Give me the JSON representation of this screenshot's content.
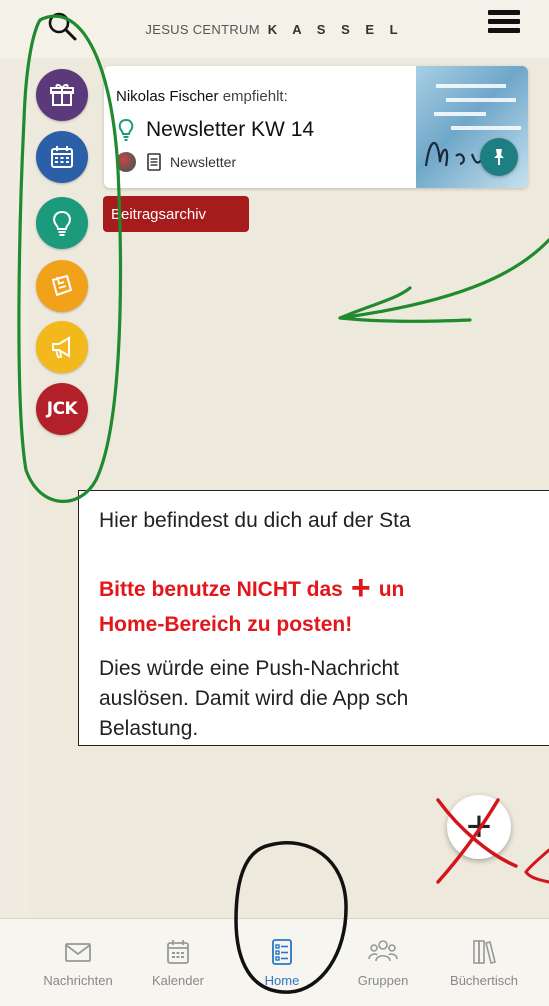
{
  "header": {
    "brand_light": "JESUS CENTRUM",
    "brand_bold": "K A S S E L"
  },
  "sidebar": {
    "items": [
      {
        "icon": "gift-icon",
        "color": "#5a3a7a"
      },
      {
        "icon": "calendar-icon",
        "color": "#2b5fa8"
      },
      {
        "icon": "lightbulb-icon",
        "color": "#1c9a7c"
      },
      {
        "icon": "note-icon",
        "color": "#f2a21a"
      },
      {
        "icon": "megaphone-icon",
        "color": "#f3b91c"
      },
      {
        "icon": "jck-logo-icon",
        "color": "#b3202a",
        "label": "JCK"
      }
    ]
  },
  "feed": {
    "card": {
      "recommender": "Nikolas Fischer",
      "recommend_label": "empfiehlt:",
      "title": "Newsletter KW 14",
      "category": "Newsletter"
    },
    "archive_button": "Beitragsarchiv"
  },
  "notice": {
    "line1": "Hier befindest du dich auf der Sta",
    "line2_before": "Bitte benutze NICHT das",
    "line2_plus": "+",
    "line2_after": "un",
    "line3": "Home-Bereich zu posten!",
    "line4": "Dies würde eine Push-Nachricht",
    "line5": "auslösen. Damit wird die App sch",
    "line6": "Belastung."
  },
  "fab": {
    "label": "+"
  },
  "bottom_nav": {
    "items": [
      {
        "label": "Nachrichten",
        "icon": "mail-icon"
      },
      {
        "label": "Kalender",
        "icon": "calendar-icon"
      },
      {
        "label": "Home",
        "icon": "list-icon",
        "active": true
      },
      {
        "label": "Gruppen",
        "icon": "group-icon"
      },
      {
        "label": "Büchertisch",
        "icon": "books-icon"
      }
    ]
  },
  "colors": {
    "accent": "#2a76c4",
    "archive": "#a61b1b",
    "warning": "#e3161b",
    "annotation_green": "#1f8a2e",
    "annotation_red": "#d2161c"
  }
}
